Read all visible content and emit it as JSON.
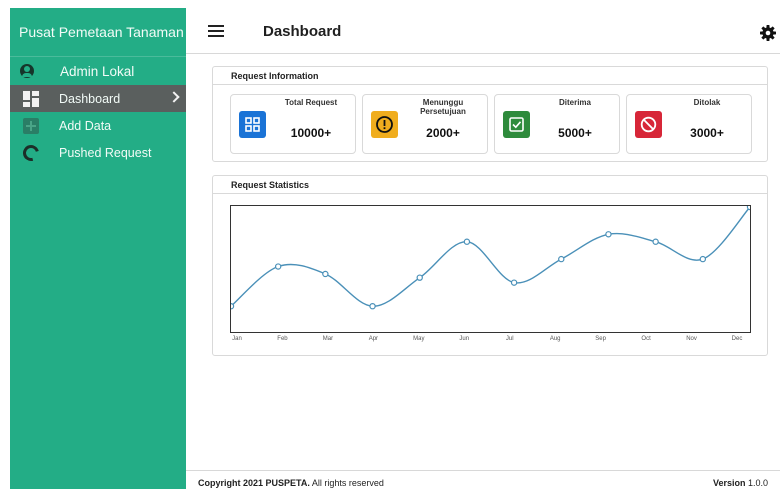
{
  "sidebar": {
    "brand": "Pusat Pemetaan Tanaman",
    "user": "Admin Lokal",
    "items": [
      {
        "label": "Dashboard",
        "icon": "dashboard-icon",
        "active": true
      },
      {
        "label": "Add Data",
        "icon": "add-data-icon",
        "active": false
      },
      {
        "label": "Pushed Request",
        "icon": "pushed-request-icon",
        "active": false
      }
    ]
  },
  "topbar": {
    "title": "Dashboard",
    "menu_icon": "hamburger-menu-icon",
    "settings_icon": "gear-icon"
  },
  "info": {
    "title": "Request Information",
    "cards": [
      {
        "label": "Total Request",
        "value": "10000+",
        "color": "#1a73d6",
        "icon": "grid-icon"
      },
      {
        "label": "Menunggu Persetujuan",
        "value": "2000+",
        "color": "#f0ad1e",
        "icon": "exclamation-icon"
      },
      {
        "label": "Diterima",
        "value": "5000+",
        "color": "#2e8b3c",
        "icon": "check-square-icon"
      },
      {
        "label": "Ditolak",
        "value": "3000+",
        "color": "#d72638",
        "icon": "ban-icon"
      }
    ]
  },
  "stats": {
    "title": "Request Statistics",
    "chart_data": {
      "type": "line",
      "categories": [
        "Jan",
        "Feb",
        "Mar",
        "Apr",
        "May",
        "Jun",
        "Jul",
        "Aug",
        "Sep",
        "Oct",
        "Nov",
        "Dec"
      ],
      "values": [
        20,
        52,
        46,
        20,
        43,
        72,
        39,
        58,
        78,
        72,
        58,
        100
      ],
      "ylim": [
        0,
        100
      ],
      "grid": false,
      "color": "#4a90b8"
    }
  },
  "footer": {
    "copyright_bold": "Copyright 2021 PUSPETA.",
    "copyright_rest": " All rights reserved",
    "version_label": "Version",
    "version": " 1.0.0"
  }
}
